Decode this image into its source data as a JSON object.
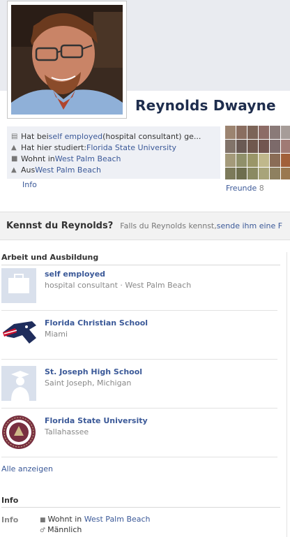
{
  "profile": {
    "name": "Reynolds Dwayne"
  },
  "about": {
    "rows": [
      {
        "icon": "briefcase-icon",
        "prefix": "Hat bei ",
        "link": "self employed",
        "suffix": " (hospital consultant) ge..."
      },
      {
        "icon": "graduation-cap-icon",
        "prefix": "Hat hier studiert: ",
        "link": "Florida State University",
        "suffix": ""
      },
      {
        "icon": "house-icon",
        "prefix": "Wohnt in ",
        "link": "West Palm Beach",
        "suffix": ""
      },
      {
        "icon": "home-town-icon",
        "prefix": "Aus ",
        "link": "West Palm Beach",
        "suffix": ""
      }
    ],
    "info_link": "Info"
  },
  "friends": {
    "label": "Freunde",
    "count": "8",
    "tile_colors": [
      "#9c8470",
      "#8a6e60",
      "#7c6458",
      "#8d6c66",
      "#8a7a78",
      "#a69c98",
      "#82746a",
      "#6a5a54",
      "#70584e",
      "#725650",
      "#7c6a6a",
      "#a07a74",
      "#a49a7a",
      "#90906a",
      "#9a9668",
      "#c0b88c",
      "#8a6c56",
      "#a2603a",
      "#7c7a5a",
      "#6e6e4e",
      "#8a8a62",
      "#a8a47a",
      "#8e8060",
      "#9a7850"
    ]
  },
  "know_bar": {
    "title": "Kennst du Reynolds?",
    "text_prefix": "Falls du Reynolds kennst, ",
    "link": "sende ihm eine F"
  },
  "work": {
    "section_title": "Arbeit und Ausbildung",
    "items": [
      {
        "name": "self employed",
        "sub": "hospital consultant · West Palm Beach",
        "logo": "briefcase-placeholder-icon"
      },
      {
        "name": "Florida Christian School",
        "sub": "Miami",
        "logo": "patriots-logo-icon"
      },
      {
        "name": "St. Joseph High School",
        "sub": "Saint Joseph, Michigan",
        "logo": "graduate-placeholder-icon"
      },
      {
        "name": "Florida State University",
        "sub": "Tallahassee",
        "logo": "fsu-seal-icon"
      }
    ],
    "show_all": "Alle anzeigen"
  },
  "info": {
    "section_title": "Info",
    "label": "Info",
    "lives_prefix": "Wohnt in ",
    "lives_link": "West Palm Beach",
    "gender": "Männlich"
  },
  "colors": {
    "link": "#3b5998",
    "name": "#1e2d4d",
    "about_bg": "#eef0f5"
  }
}
